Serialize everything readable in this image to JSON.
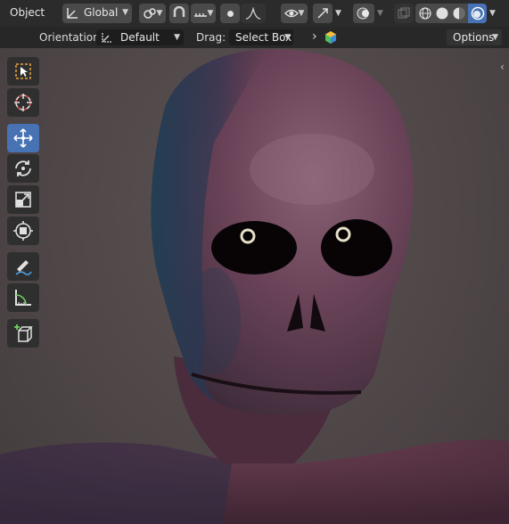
{
  "header": {
    "mode": "Object",
    "transform_orientation": "Global",
    "options_label": "Options"
  },
  "tool_settings": {
    "orientation_label": "Orientation:",
    "orientation_value": "Default",
    "drag_label": "Drag:",
    "drag_value": "Select Box"
  },
  "toolbar": {
    "tools": [
      "select-box",
      "cursor",
      "move",
      "rotate",
      "scale",
      "transform",
      "annotate",
      "measure",
      "add-cube"
    ],
    "active_tool": "move"
  },
  "colors": {
    "header_bg": "#2b2b2b",
    "active_tool": "#4772b3",
    "viewport_bg": "#4d4546"
  }
}
